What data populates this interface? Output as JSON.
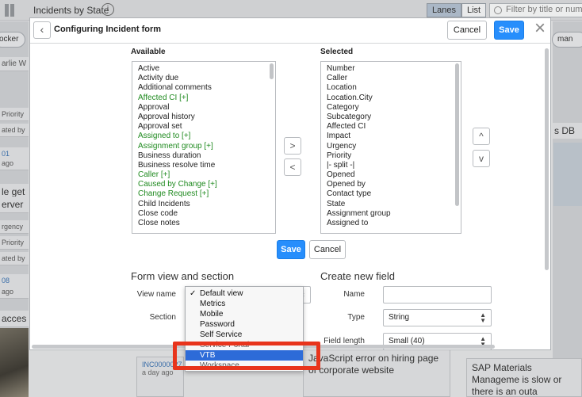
{
  "background": {
    "title": "Incidents by State",
    "tabs": [
      "Lanes",
      "List"
    ],
    "filter_placeholder": "Filter by title or numb",
    "left_pills": [
      "ocker"
    ],
    "left_cards": [
      {
        "big": "arlie W",
        "small": ""
      },
      {
        "big": "",
        "small": "Priority"
      },
      {
        "big": "",
        "small": "ated by"
      },
      {
        "big": "",
        "small": "01"
      },
      {
        "big": "",
        "small": "ago"
      },
      {
        "big": "le get",
        "small": ""
      },
      {
        "big": "erver",
        "small": ""
      },
      {
        "big": "",
        "small": "rgency"
      },
      {
        "big": "",
        "small": "Priority"
      },
      {
        "big": "",
        "small": "ated by"
      },
      {
        "big": "",
        "small": "08"
      },
      {
        "big": "",
        "small": "ago"
      },
      {
        "big": "acces",
        "small": ""
      }
    ],
    "right_pill": "man",
    "right_card": "s DB",
    "bottom_cards": [
      {
        "id": "INC0000027",
        "ago": "a day ago",
        "text": ""
      },
      {
        "id": "",
        "ago": "",
        "text": "JavaScript error on hiring page of corporate website"
      },
      {
        "id": "",
        "ago": "",
        "text": "SAP Materials Manageme is slow or there is an outa"
      }
    ]
  },
  "modal": {
    "title": "Configuring Incident form",
    "cancel_label": "Cancel",
    "save_label": "Save",
    "close_icon": "×",
    "available_label": "Available",
    "selected_label": "Selected",
    "available_items": [
      {
        "label": "Active",
        "green": false
      },
      {
        "label": "Activity due",
        "green": false
      },
      {
        "label": "Additional comments",
        "green": false
      },
      {
        "label": "Affected CI [+]",
        "green": true
      },
      {
        "label": "Approval",
        "green": false
      },
      {
        "label": "Approval history",
        "green": false
      },
      {
        "label": "Approval set",
        "green": false
      },
      {
        "label": "Assigned to [+]",
        "green": true
      },
      {
        "label": "Assignment group [+]",
        "green": true
      },
      {
        "label": "Business duration",
        "green": false
      },
      {
        "label": "Business resolve time",
        "green": false
      },
      {
        "label": "Caller [+]",
        "green": true
      },
      {
        "label": "Caused by Change [+]",
        "green": true
      },
      {
        "label": "Change Request [+]",
        "green": true
      },
      {
        "label": "Child Incidents",
        "green": false
      },
      {
        "label": "Close code",
        "green": false
      },
      {
        "label": "Close notes",
        "green": false
      }
    ],
    "selected_items": [
      "Number",
      "Caller",
      "Location",
      "Location.City",
      "Category",
      "Subcategory",
      "Affected CI",
      "Impact",
      "Urgency",
      "Priority",
      "|- split -|",
      "Opened",
      "Opened by",
      "Contact type",
      "State",
      "Assignment group",
      "Assigned to"
    ],
    "move_right_icon": ">",
    "move_left_icon": "<",
    "move_up_icon": "^",
    "move_down_icon": "v",
    "list_save_label": "Save",
    "list_cancel_label": "Cancel",
    "form_view_title": "Form view and section",
    "view_name_label": "View name",
    "section_label": "Section",
    "create_field_title": "Create new field",
    "name_label": "Name",
    "name_value": "",
    "type_label": "Type",
    "type_value": "String",
    "field_length_label": "Field length",
    "field_length_value": "Small (40)"
  },
  "dropdown": {
    "options": [
      "Default view",
      "Metrics",
      "Mobile",
      "Password",
      "Self Service",
      "Service Portal",
      "VTB",
      "Workspace"
    ],
    "checked_index": 0,
    "highlighted_index": 6,
    "check_mark": "✓"
  },
  "colors": {
    "primary": "#278efc",
    "green_item": "#1f8a1f",
    "highlight_outline": "#e8341c",
    "selected_option": "#2d6bd8"
  }
}
